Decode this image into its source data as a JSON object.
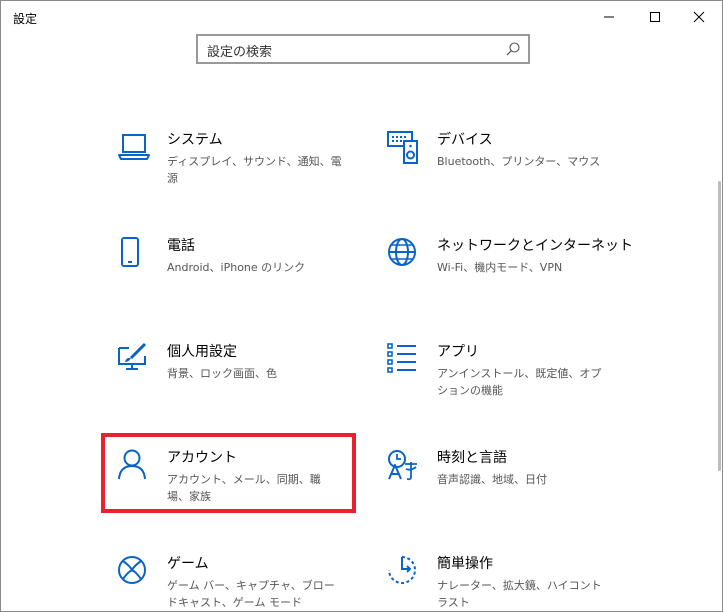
{
  "window": {
    "title": "設定"
  },
  "search": {
    "text": "設定の検索"
  },
  "tiles": [
    {
      "title": "システム",
      "desc": "ディスプレイ、サウンド、通知、電源"
    },
    {
      "title": "デバイス",
      "desc": "Bluetooth、プリンター、マウス"
    },
    {
      "title": "電話",
      "desc": "Android、iPhone のリンク"
    },
    {
      "title": "ネットワークとインターネット",
      "desc": "Wi-Fi、機内モード、VPN"
    },
    {
      "title": "個人用設定",
      "desc": "背景、ロック画面、色"
    },
    {
      "title": "アプリ",
      "desc": "アンインストール、既定値、オプションの機能"
    },
    {
      "title": "アカウント",
      "desc": "アカウント、メール、同期、職場、家族"
    },
    {
      "title": "時刻と言語",
      "desc": "音声認識、地域、日付"
    },
    {
      "title": "ゲーム",
      "desc": "ゲーム バー、キャプチャ、ブロードキャスト、ゲーム モード"
    },
    {
      "title": "簡単操作",
      "desc": "ナレーター、拡大鏡、ハイコントラスト"
    }
  ],
  "colors": {
    "accent": "#0a64c8",
    "highlight": "#e8212d"
  }
}
